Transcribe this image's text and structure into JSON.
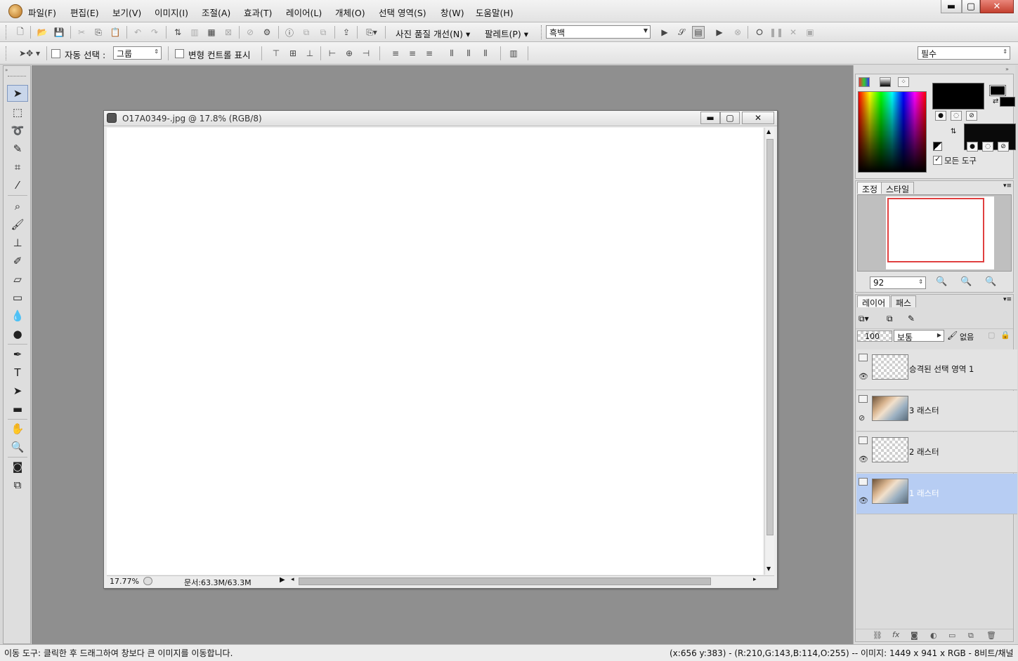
{
  "menu": {
    "items": [
      "파일(F)",
      "편집(E)",
      "보기(V)",
      "이미지(I)",
      "조절(A)",
      "효과(T)",
      "레이어(L)",
      "개체(O)",
      "선택 영역(S)",
      "창(W)",
      "도움말(H)"
    ]
  },
  "window_controls": {
    "minimize": "▬",
    "maximize": "▢",
    "close": "✕"
  },
  "toolbar1": {
    "enhance_menu": "사진 품질 개선(N) ▾",
    "palette_menu": "팔레트(P) ▾",
    "script_combo": "흑백"
  },
  "toolbar2": {
    "auto_select_label": "자동 선택 :",
    "auto_select_value": "그룹",
    "transform_label": "변형 컨트롤 표시",
    "workspace_value": "필수"
  },
  "document": {
    "title": "O17A0349-.jpg @ 17.8% (RGB/8)",
    "zoom": "17.77%",
    "doc_size": "문서:63.3M/63.3M"
  },
  "color_panel": {
    "all_tools_label": "모든 도구"
  },
  "navigator": {
    "tabs": [
      "조정",
      "스타일"
    ],
    "zoom_value": "92"
  },
  "layers_panel": {
    "tabs": [
      "레이어",
      "패스"
    ],
    "opacity": "100",
    "blend_mode": "보통",
    "lock_label": "없음",
    "layers": [
      {
        "name": "승격된 선택 영역 1",
        "thumb": "checker",
        "visible": true,
        "selected": false
      },
      {
        "name": "3 래스터",
        "thumb": "photo",
        "visible": false,
        "selected": false
      },
      {
        "name": "2 래스터",
        "thumb": "checker",
        "visible": true,
        "selected": false
      },
      {
        "name": "1 래스터",
        "thumb": "photo",
        "visible": true,
        "selected": true
      }
    ]
  },
  "status": {
    "hint": "이동 도구: 클릭한 후 드래그하여 창보다 큰 이미지를 이동합니다.",
    "info": "(x:656 y:383) - (R:210,G:143,B:114,O:255) -- 이미지: 1449 x 941 x RGB - 8비트/채널"
  },
  "colors": {
    "workspace_bg": "#8f8f8f",
    "selection": "#b7cdf3",
    "navigator_frame": "#e04040"
  }
}
